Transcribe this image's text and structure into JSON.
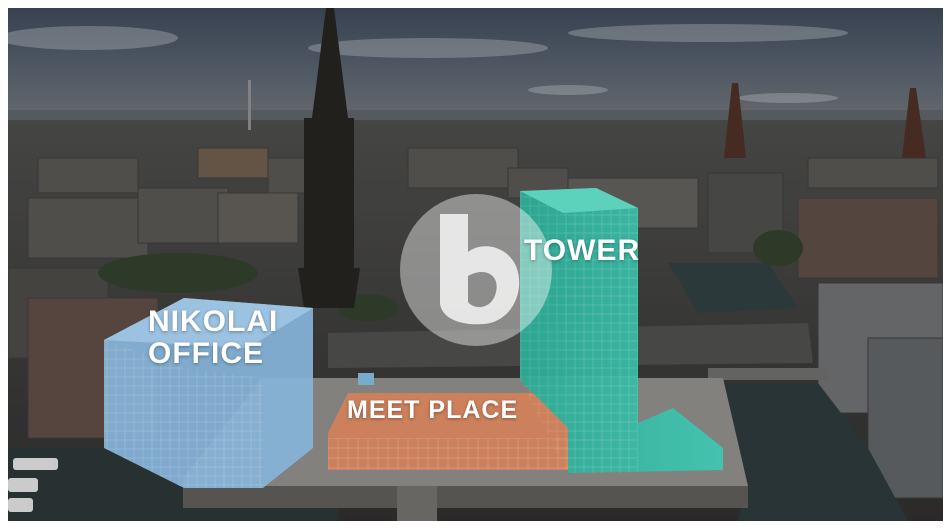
{
  "scene": "Aerial view of a waterfront city district with highlighted building project",
  "labels": {
    "nikolai_line1": "NIKOLAI",
    "nikolai_line2": "OFFICE",
    "meet_place": "MEET PLACE",
    "tower": "TOWER"
  },
  "logo": {
    "glyph": "b",
    "icon": "b-logo-icon"
  },
  "colors": {
    "sky": "#3c4a5c",
    "city": "#3b3a38",
    "water": "#2d3b3c",
    "nikolai": "#8fc0e8",
    "meet_place": "#d98a62",
    "tower": "#3fd0b8"
  }
}
